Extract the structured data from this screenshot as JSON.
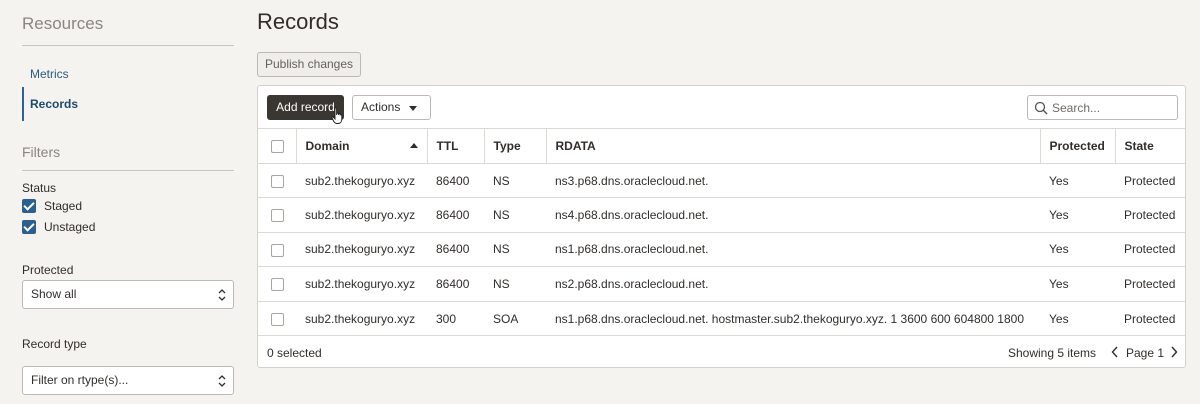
{
  "sidebar": {
    "resources_title": "Resources",
    "nav": [
      {
        "label": "Metrics"
      },
      {
        "label": "Records"
      }
    ],
    "filters_title": "Filters",
    "status_label": "Status",
    "status_options": [
      {
        "label": "Staged",
        "checked": true
      },
      {
        "label": "Unstaged",
        "checked": true
      }
    ],
    "protected_label": "Protected",
    "protected_value": "Show all",
    "record_type_label": "Record type",
    "record_type_placeholder": "Filter on rtype(s)..."
  },
  "main": {
    "title": "Records",
    "publish_label": "Publish changes",
    "add_record_label": "Add record",
    "actions_label": "Actions",
    "search_placeholder": "Search...",
    "columns": [
      "Domain",
      "TTL",
      "Type",
      "RDATA",
      "Protected",
      "State"
    ],
    "rows": [
      {
        "domain": "sub2.thekoguryo.xyz",
        "ttl": "86400",
        "type": "NS",
        "rdata": "ns3.p68.dns.oraclecloud.net.",
        "protected": "Yes",
        "state": "Protected"
      },
      {
        "domain": "sub2.thekoguryo.xyz",
        "ttl": "86400",
        "type": "NS",
        "rdata": "ns4.p68.dns.oraclecloud.net.",
        "protected": "Yes",
        "state": "Protected"
      },
      {
        "domain": "sub2.thekoguryo.xyz",
        "ttl": "86400",
        "type": "NS",
        "rdata": "ns1.p68.dns.oraclecloud.net.",
        "protected": "Yes",
        "state": "Protected"
      },
      {
        "domain": "sub2.thekoguryo.xyz",
        "ttl": "86400",
        "type": "NS",
        "rdata": "ns2.p68.dns.oraclecloud.net.",
        "protected": "Yes",
        "state": "Protected"
      },
      {
        "domain": "sub2.thekoguryo.xyz",
        "ttl": "300",
        "type": "SOA",
        "rdata": "ns1.p68.dns.oraclecloud.net. hostmaster.sub2.thekoguryo.xyz. 1 3600 600 604800 1800",
        "protected": "Yes",
        "state": "Protected"
      }
    ],
    "selected_count": "0 selected",
    "showing": "Showing 5 items",
    "page_label": "Page 1"
  },
  "colors": {
    "accent": "#2a5f8f",
    "primary_button": "#3a3632",
    "background": "#f4f3ef"
  }
}
